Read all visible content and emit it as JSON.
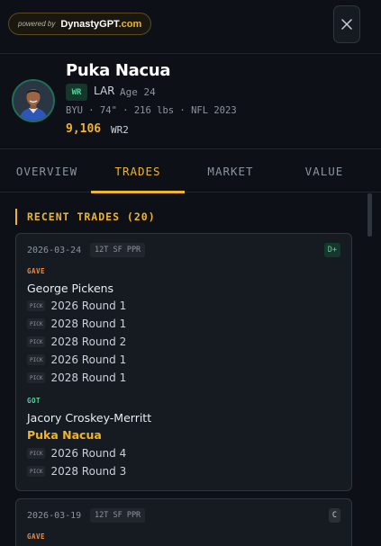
{
  "branding": {
    "powered_by": "powered by",
    "brand_name": "DynastyGPT",
    "brand_domain": ".com"
  },
  "header": {
    "close_icon": "close-icon"
  },
  "player": {
    "name": "Puka Nacua",
    "position": "WR",
    "team": "LAR",
    "age": "Age 24",
    "bio": "BYU · 74\" · 216 lbs · NFL 2023",
    "value": "9,106",
    "rank": "WR2"
  },
  "tabs": [
    {
      "label": "OVERVIEW",
      "active": false
    },
    {
      "label": "TRADES",
      "active": true
    },
    {
      "label": "MARKET",
      "active": false
    },
    {
      "label": "VALUE",
      "active": false
    }
  ],
  "section_title": "RECENT TRADES (20)",
  "trades": [
    {
      "date": "2026-03-24",
      "format": "12T SF PPR",
      "grade": "D+",
      "gave_label": "GAVE",
      "gave_players": [
        "George Pickens"
      ],
      "gave_picks": [
        "2026 Round 1",
        "2028 Round 1",
        "2028 Round 2",
        "2026 Round 1",
        "2028 Round 1"
      ],
      "got_label": "GOT",
      "got_players": [
        "Jacory Croskey-Merritt",
        "Puka Nacua"
      ],
      "got_picks": [
        "2026 Round 4",
        "2028 Round 3"
      ]
    },
    {
      "date": "2026-03-19",
      "format": "12T SF PPR",
      "grade": "C",
      "gave_label": "GAVE"
    }
  ],
  "pick_tag": "PICK",
  "colors": {
    "accent": "#f0b429",
    "background": "#0d1117",
    "card": "#161b22",
    "got": "#56d39a",
    "gave": "#f0883e"
  }
}
